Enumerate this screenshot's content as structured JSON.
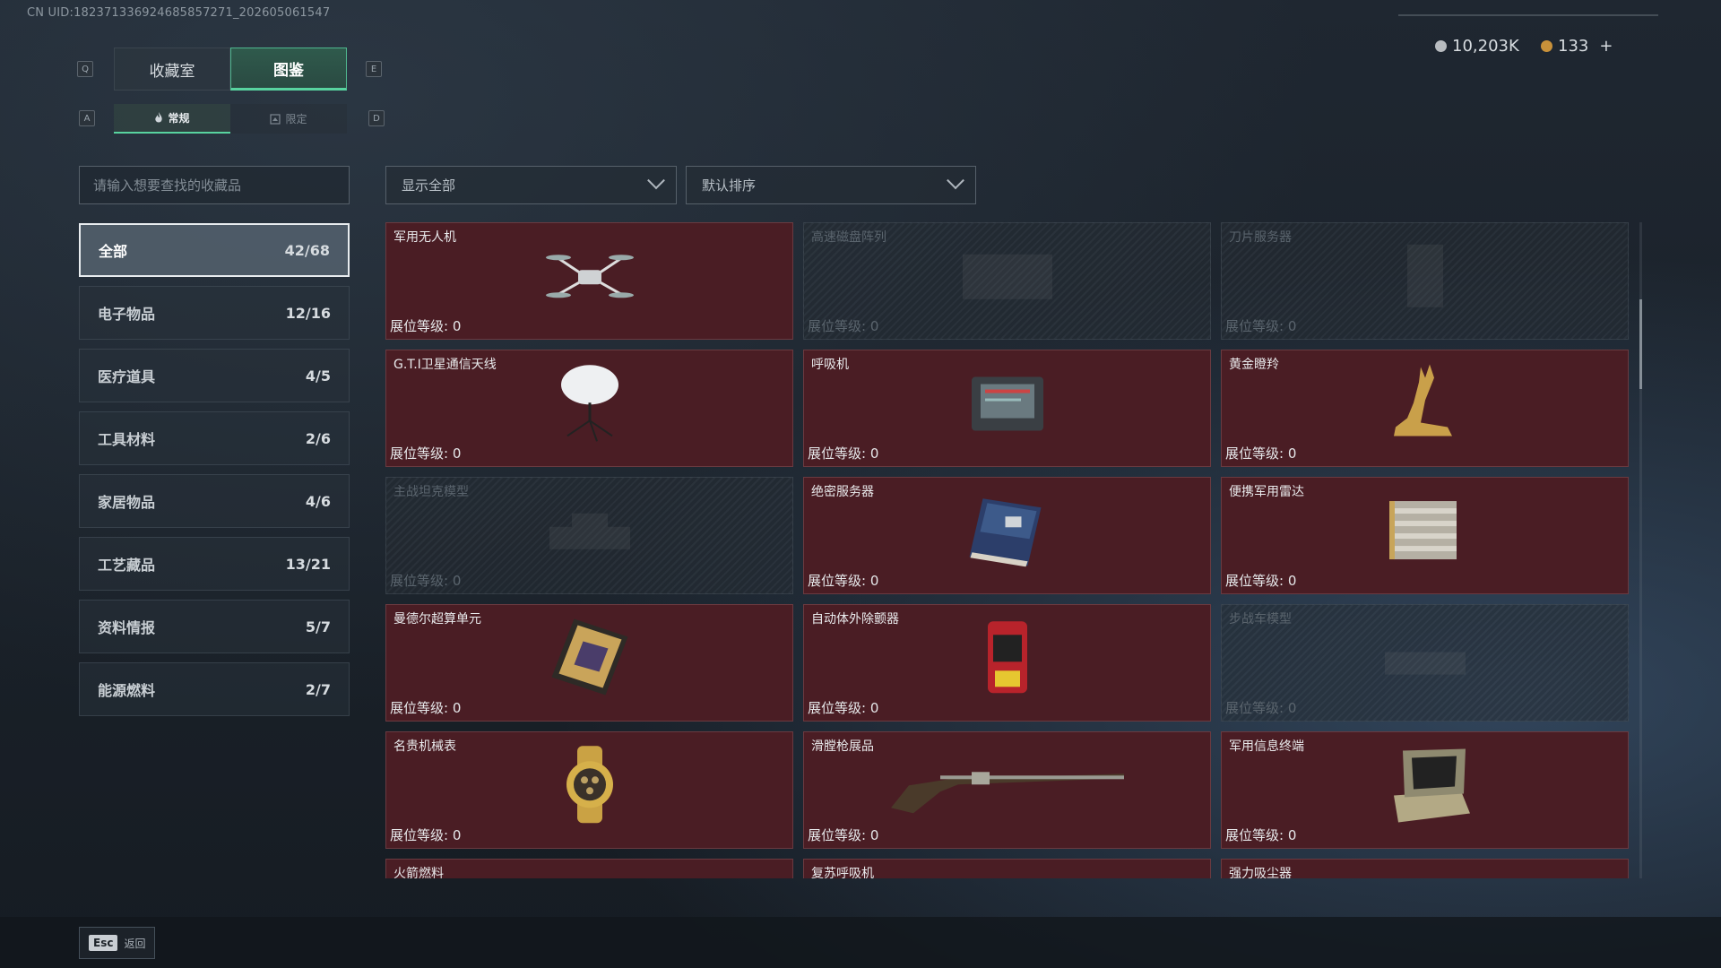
{
  "uid": "CN UID:1823713369246858572​71_202605061547",
  "tabs": [
    {
      "label": "收藏室",
      "key": "Q"
    },
    {
      "label": "图鉴",
      "key": "E"
    }
  ],
  "subtabs": [
    {
      "label": "常规",
      "key": "A"
    },
    {
      "label": "限定",
      "key": "D"
    }
  ],
  "currency": {
    "silver": "10,203K",
    "gold": "133",
    "plus": "+",
    "silver_color": "#b8bcc0",
    "gold_color": "#c8913a"
  },
  "search": {
    "placeholder": "请输入想要查找的收藏品"
  },
  "categories": [
    {
      "label": "全部",
      "count": "42/68"
    },
    {
      "label": "电子物品",
      "count": "12/16"
    },
    {
      "label": "医疗道具",
      "count": "4/5"
    },
    {
      "label": "工具材料",
      "count": "2/6"
    },
    {
      "label": "家居物品",
      "count": "4/6"
    },
    {
      "label": "工艺藏品",
      "count": "13/21"
    },
    {
      "label": "资料情报",
      "count": "5/7"
    },
    {
      "label": "能源燃料",
      "count": "2/7"
    }
  ],
  "filters": {
    "display": "显示全部",
    "sort": "默认排序"
  },
  "items": [
    {
      "name": "军用无人机",
      "level": "展位等级: 0",
      "locked": false,
      "icon": "drone-icon"
    },
    {
      "name": "高速磁盘阵列",
      "level": "展位等级: 0",
      "locked": true,
      "icon": "disk-array-icon"
    },
    {
      "name": "刀片服务器",
      "level": "展位等级: 0",
      "locked": true,
      "icon": "blade-server-icon"
    },
    {
      "name": "G.T.I卫星通信天线",
      "level": "展位等级: 0",
      "locked": false,
      "icon": "satellite-dish-icon"
    },
    {
      "name": "呼吸机",
      "level": "展位等级: 0",
      "locked": false,
      "icon": "ventilator-icon"
    },
    {
      "name": "黄金瞪羚",
      "level": "展位等级: 0",
      "locked": false,
      "icon": "golden-gazelle-icon"
    },
    {
      "name": "主战坦克模型",
      "level": "展位等级: 0",
      "locked": true,
      "icon": "tank-model-icon"
    },
    {
      "name": "绝密服务器",
      "level": "展位等级: 0",
      "locked": false,
      "icon": "secret-server-icon"
    },
    {
      "name": "便携军用雷达",
      "level": "展位等级: 0",
      "locked": false,
      "icon": "radar-icon"
    },
    {
      "name": "曼德尔超算单元",
      "level": "展位等级: 0",
      "locked": false,
      "icon": "supercompute-unit-icon"
    },
    {
      "name": "自动体外除颤器",
      "level": "展位等级: 0",
      "locked": false,
      "icon": "defibrillator-icon"
    },
    {
      "name": "步战车模型",
      "level": "展位等级: 0",
      "locked": true,
      "icon": "ifv-model-icon"
    },
    {
      "name": "名贵机械表",
      "level": "展位等级: 0",
      "locked": false,
      "icon": "watch-icon"
    },
    {
      "name": "滑膛枪展品",
      "level": "展位等级: 0",
      "locked": false,
      "icon": "musket-icon"
    },
    {
      "name": "军用信息终端",
      "level": "展位等级: 0",
      "locked": false,
      "icon": "terminal-icon"
    },
    {
      "name": "火箭燃料",
      "level": "",
      "locked": false,
      "icon": "rocket-fuel-icon"
    },
    {
      "name": "复苏呼吸机",
      "level": "",
      "locked": false,
      "icon": "resuscitator-icon"
    },
    {
      "name": "强力吸尘器",
      "level": "",
      "locked": false,
      "icon": "vacuum-icon"
    }
  ],
  "footer": {
    "esc_key": "Esc",
    "esc_label": "返回"
  }
}
